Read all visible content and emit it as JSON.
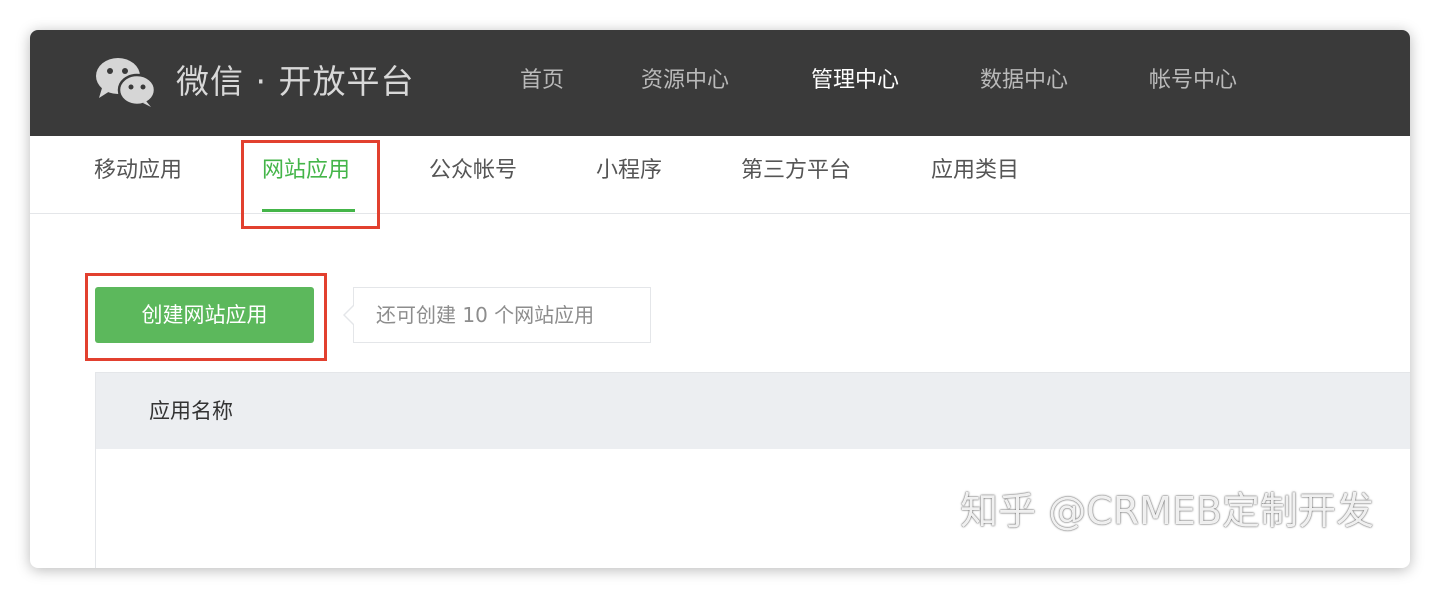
{
  "header": {
    "brand": "微信 · 开放平台",
    "nav": [
      {
        "label": "首页"
      },
      {
        "label": "资源中心"
      },
      {
        "label": "管理中心"
      },
      {
        "label": "数据中心"
      },
      {
        "label": "帐号中心"
      }
    ],
    "active_nav": "管理中心"
  },
  "subnav": {
    "tabs": [
      {
        "label": "移动应用"
      },
      {
        "label": "网站应用"
      },
      {
        "label": "公众帐号"
      },
      {
        "label": "小程序"
      },
      {
        "label": "第三方平台"
      },
      {
        "label": "应用类目"
      }
    ],
    "active_tab": "网站应用"
  },
  "main": {
    "create_button_label": "创建网站应用",
    "tip_text": "还可创建 10 个网站应用",
    "table": {
      "columns": [
        "应用名称"
      ]
    }
  },
  "watermark": "知乎 @CRMEB定制开发",
  "colors": {
    "topbar_bg": "#3a3a3a",
    "accent_green": "#44b549",
    "button_green": "#5cb85c",
    "highlight_red": "#e2402f"
  },
  "icons": {
    "logo": "wechat-logo-icon"
  }
}
